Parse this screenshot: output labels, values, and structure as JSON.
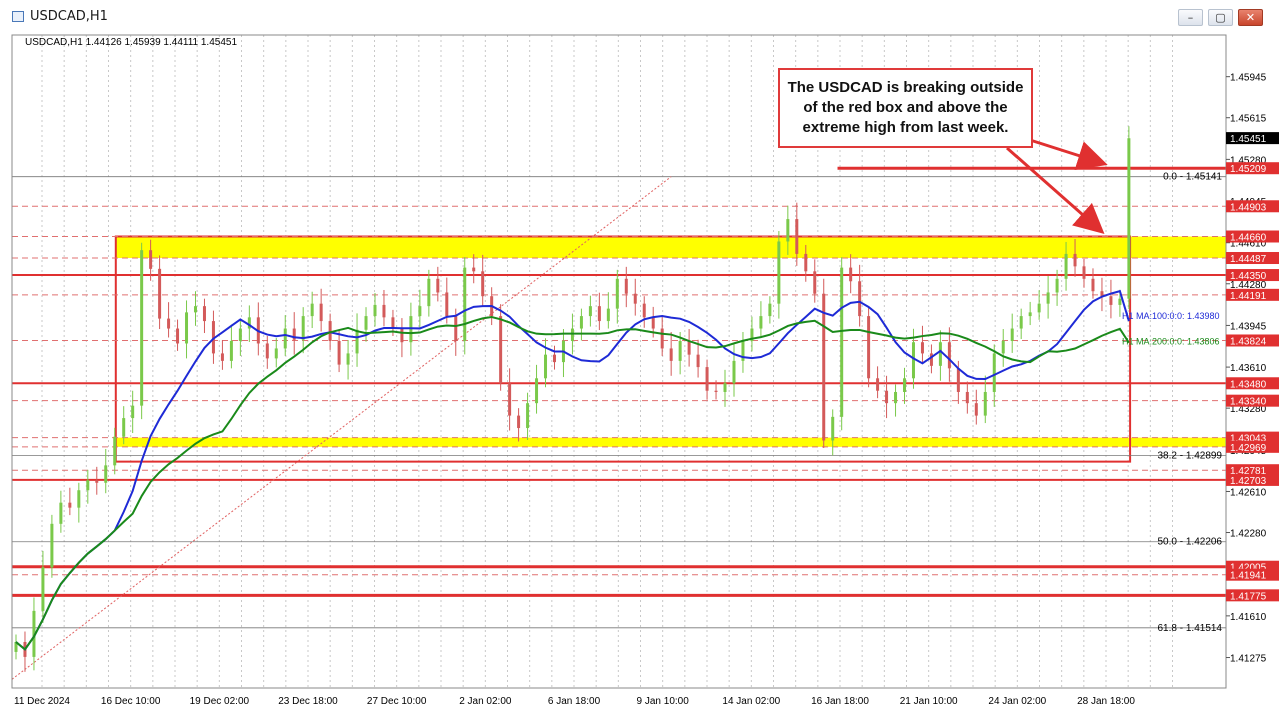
{
  "window": {
    "title": "USDCAD,H1",
    "min_label": "–",
    "max_label": "▢",
    "close_label": "✕"
  },
  "symbol_header": "USDCAD,H1  1.44126 1.45939 1.44111 1.45451",
  "annotation": {
    "lines": [
      "The USDCAD is breaking outside",
      "of the red box and above the",
      "extreme high from last week."
    ]
  },
  "colors": {
    "red": "#e03030",
    "yellow": "#ffff00",
    "blue": "#1e2ad6",
    "green": "#1a8a1a",
    "candle_up": "#7ac94a",
    "candle_down": "#d35a5a",
    "grid": "#c8c8c8"
  },
  "chart_data": {
    "type": "line",
    "ylim": [
      1.4103,
      1.4628
    ],
    "y_ticks": [
      "1.45945",
      "1.45615",
      "1.45280",
      "1.44945",
      "1.44610",
      "1.44280",
      "1.43945",
      "1.43610",
      "1.43280",
      "1.42945",
      "1.42610",
      "1.42280",
      "1.41945",
      "1.41610",
      "1.41275"
    ],
    "x_ticks": [
      "11 Dec 2024",
      "16 Dec 10:00",
      "19 Dec 02:00",
      "23 Dec 18:00",
      "27 Dec 10:00",
      "2 Jan 02:00",
      "6 Jan 18:00",
      "9 Jan 10:00",
      "14 Jan 02:00",
      "16 Jan 18:00",
      "21 Jan 10:00",
      "24 Jan 02:00",
      "28 Jan 18:00"
    ],
    "current_price": "1.45451",
    "horizontal_levels": [
      {
        "value": 1.45209,
        "label": "1.45209",
        "style": "solid-red",
        "width": 3,
        "x_start_frac": 0.68
      },
      {
        "value": 1.44903,
        "label": "1.44903",
        "style": "dashed-red"
      },
      {
        "value": 1.4466,
        "label": "1.44660",
        "style": "dashed-red"
      },
      {
        "value": 1.44487,
        "label": "1.44487",
        "style": "dashed-red"
      },
      {
        "value": 1.4435,
        "label": "1.44350",
        "style": "solid-red",
        "width": 2
      },
      {
        "value": 1.44191,
        "label": "1.44191",
        "style": "dashed-red"
      },
      {
        "value": 1.43824,
        "label": "1.43824",
        "style": "dashed-red"
      },
      {
        "value": 1.4348,
        "label": "1.43480",
        "style": "solid-red",
        "width": 2
      },
      {
        "value": 1.4334,
        "label": "1.43340",
        "style": "dashed-red"
      },
      {
        "value": 1.43043,
        "label": "1.43043",
        "style": "dashed-red"
      },
      {
        "value": 1.42969,
        "label": "1.42969",
        "style": "dashed-red"
      },
      {
        "value": 1.42781,
        "label": "1.42781",
        "style": "dashed-red"
      },
      {
        "value": 1.42703,
        "label": "1.42703",
        "style": "solid-red",
        "width": 2
      },
      {
        "value": 1.42005,
        "label": "1.42005",
        "style": "solid-red",
        "width": 3
      },
      {
        "value": 1.41941,
        "label": "1.41941",
        "style": "dashed-red"
      },
      {
        "value": 1.41775,
        "label": "1.41775",
        "style": "solid-red",
        "width": 3
      }
    ],
    "fib_levels": [
      {
        "value": 1.45141,
        "label": "0.0 - 1.45141"
      },
      {
        "value": 1.42899,
        "label": "38.2 - 1.42899"
      },
      {
        "value": 1.42206,
        "label": "50.0 - 1.42206"
      },
      {
        "value": 1.41514,
        "label": "61.8 - 1.41514"
      }
    ],
    "ma_labels": {
      "ma100": "H1 MA:100:0:0: 1.43980",
      "ma200": "H1 MA:200:0:0: 1.43806"
    },
    "ma100_last": 1.4398,
    "ma200_last": 1.43806,
    "red_box": {
      "top": 1.4466,
      "bottom": 1.4285,
      "x_start_frac": 0.0855,
      "x_end_frac": 0.921
    },
    "yellow_zones": [
      {
        "top": 1.4466,
        "bottom": 1.44487
      },
      {
        "top": 1.43043,
        "bottom": 1.42969
      }
    ],
    "close_path": [
      1.414,
      1.4128,
      1.4165,
      1.42,
      1.4235,
      1.4252,
      1.4248,
      1.4262,
      1.427,
      1.4268,
      1.4282,
      1.4305,
      1.432,
      1.433,
      1.4455,
      1.444,
      1.44,
      1.4392,
      1.438,
      1.4405,
      1.441,
      1.4398,
      1.4372,
      1.4366,
      1.4382,
      1.4392,
      1.4401,
      1.438,
      1.4368,
      1.4376,
      1.4392,
      1.4383,
      1.4402,
      1.4412,
      1.4398,
      1.4382,
      1.4363,
      1.4372,
      1.4391,
      1.4402,
      1.4411,
      1.4401,
      1.4392,
      1.4381,
      1.4402,
      1.441,
      1.4432,
      1.4421,
      1.4402,
      1.4382,
      1.4441,
      1.4438,
      1.4418,
      1.4402,
      1.4348,
      1.4322,
      1.4312,
      1.4332,
      1.4352,
      1.4371,
      1.4365,
      1.4382,
      1.4392,
      1.4402,
      1.441,
      1.4398,
      1.4408,
      1.4432,
      1.442,
      1.4412,
      1.4401,
      1.4392,
      1.4376,
      1.4366,
      1.4382,
      1.4371,
      1.4361,
      1.4342,
      1.4341,
      1.4348,
      1.4366,
      1.4382,
      1.4392,
      1.4402,
      1.4412,
      1.4462,
      1.448,
      1.4452,
      1.4438,
      1.442,
      1.4302,
      1.4321,
      1.4441,
      1.443,
      1.4402,
      1.4352,
      1.4342,
      1.4332,
      1.4341,
      1.4352,
      1.4381,
      1.4372,
      1.4362,
      1.4381,
      1.436,
      1.4341,
      1.4332,
      1.4322,
      1.4341,
      1.4372,
      1.4382,
      1.4392,
      1.4402,
      1.4405,
      1.4412,
      1.4421,
      1.4432,
      1.4452,
      1.4442,
      1.4432,
      1.4422,
      1.4418,
      1.4411,
      1.4416,
      1.4545
    ]
  }
}
